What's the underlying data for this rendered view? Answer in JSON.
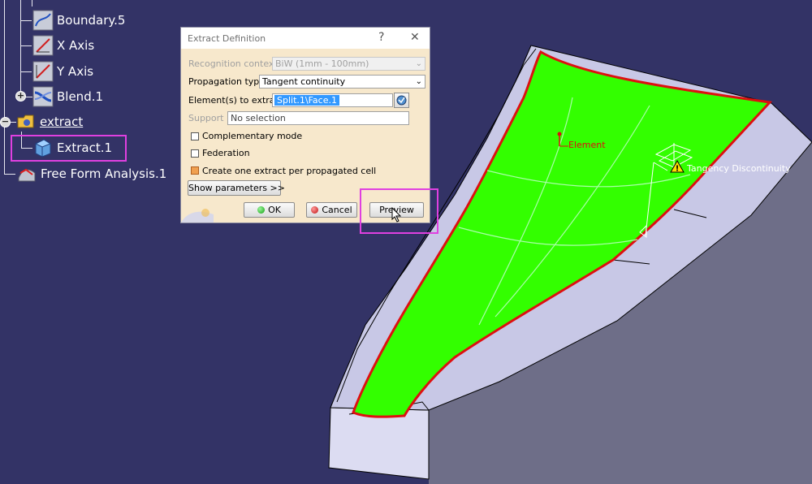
{
  "tree": {
    "items": [
      {
        "label": "Boundary.5",
        "icon": "boundary-icon"
      },
      {
        "label": "X Axis",
        "icon": "axis-icon"
      },
      {
        "label": "Y Axis",
        "icon": "axis-icon"
      },
      {
        "label": "Blend.1",
        "icon": "blend-icon"
      },
      {
        "label": "extract",
        "icon": "geometrical-set-icon"
      },
      {
        "label": "Extract.1",
        "icon": "extract-icon"
      },
      {
        "label": "Free Form Analysis.1",
        "icon": "analysis-icon"
      }
    ],
    "expander_plus": "+",
    "expander_minus": "−"
  },
  "dialog": {
    "title": "Extract Definition",
    "help": "?",
    "close": "✕",
    "recognition_context_label": "Recognition context:",
    "recognition_context_value": "BiW (1mm - 100mm)",
    "propagation_type_label": "Propagation type:",
    "propagation_type_value": "Tangent continuity",
    "elements_label": "Element(s) to extract",
    "elements_value": "Split.1\\Face.1",
    "support_label": "Support :",
    "support_value": "No selection",
    "complementary_label": "Complementary mode",
    "federation_label": "Federation",
    "per_cell_label": "Create one extract per propagated cell",
    "show_params_label": "Show parameters >>",
    "ok_label": "OK",
    "cancel_label": "Cancel",
    "preview_label": "Preview"
  },
  "viewport": {
    "element_label": "Element",
    "tangency_label": "Tangency Discontinuity"
  },
  "colors": {
    "background": "#333366",
    "highlight": "#e040e0",
    "extract_face": "#33ff00",
    "edge_red": "#dd1010",
    "block_top": "#c8c8e6",
    "block_side": "#6e6e88"
  }
}
